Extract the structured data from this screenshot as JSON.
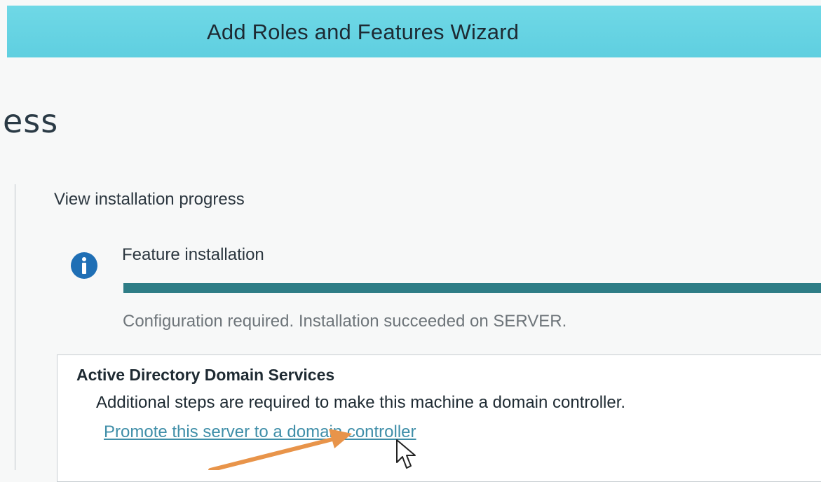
{
  "window": {
    "title": "Add Roles and Features Wizard"
  },
  "page": {
    "heading": "ess"
  },
  "progress_section": {
    "label": "View installation progress",
    "feature_title": "Feature installation",
    "progress_fraction": 1.0,
    "status": "Configuration required. Installation succeeded on SERVER."
  },
  "result": {
    "title": "Active Directory Domain Services",
    "description": "Additional steps are required to make this machine a domain controller.",
    "link": "Promote this server to a domain controller"
  },
  "icons": {
    "info": "info-icon",
    "cursor": "mouse-pointer-icon",
    "annotation": "orange-arrow"
  },
  "colors": {
    "titlebar": "#62d2e2",
    "progress": "#2e7d86",
    "link": "#3f8ea8",
    "arrow": "#e8944a",
    "info_icon": "#1f6fb5"
  }
}
